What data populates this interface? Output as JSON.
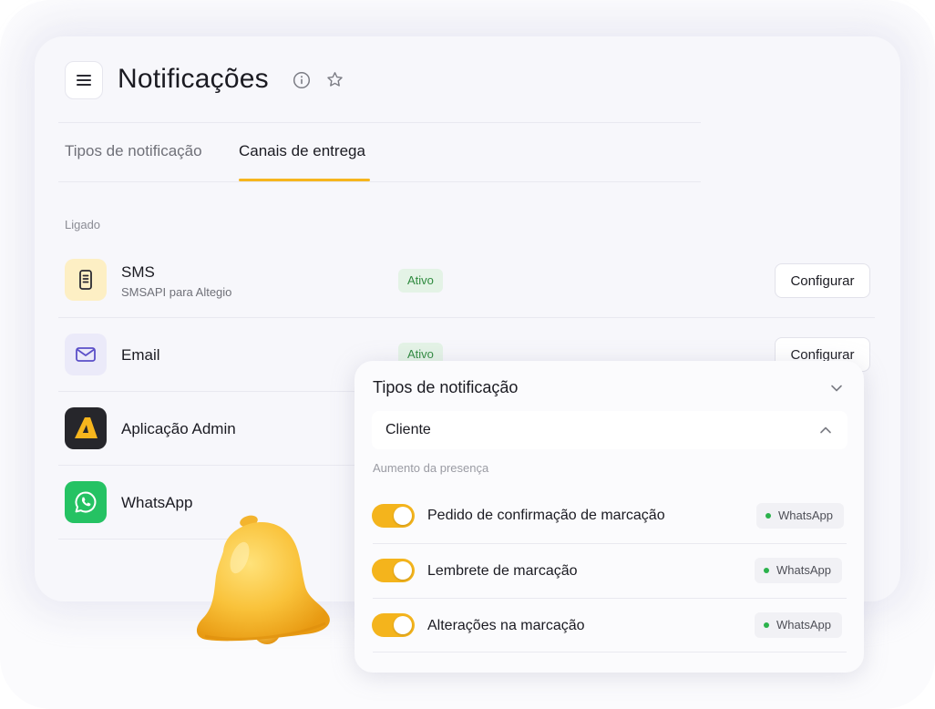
{
  "header": {
    "title": "Notificações",
    "menu_icon": "hamburger-menu-icon",
    "info_icon": "info-icon",
    "favorite_icon": "star-icon"
  },
  "tabs": [
    {
      "label": "Tipos de notificação",
      "active": false
    },
    {
      "label": "Canais de entrega",
      "active": true
    }
  ],
  "channels": {
    "section_label": "Ligado",
    "items": [
      {
        "name": "SMS",
        "subtitle": "SMSAPI para Altegio",
        "status": "Ativo",
        "action": "Configurar",
        "icon": "phone-icon"
      },
      {
        "name": "Email",
        "subtitle": "",
        "status": "Ativo",
        "action": "Configurar",
        "icon": "mail-icon"
      },
      {
        "name": "Aplicação Admin",
        "subtitle": "",
        "status": "",
        "action": "",
        "icon": "altegio-logo-icon"
      },
      {
        "name": "WhatsApp",
        "subtitle": "",
        "status": "",
        "action": "",
        "icon": "whatsapp-icon"
      }
    ]
  },
  "popup": {
    "title": "Tipos de notificação",
    "dropdown_value": "Cliente",
    "group_label": "Aumento da presença",
    "items": [
      {
        "label": "Pedido de confirmação de marcação",
        "enabled": true,
        "channel": "WhatsApp"
      },
      {
        "label": "Lembrete de marcação",
        "enabled": true,
        "channel": "WhatsApp"
      },
      {
        "label": "Alterações na marcação",
        "enabled": true,
        "channel": "WhatsApp"
      }
    ]
  },
  "decoration": {
    "icon": "bell-icon"
  },
  "colors": {
    "accent": "#F6B51D",
    "status_green_bg": "#E4F3E6",
    "status_green_text": "#2E8A3E",
    "whatsapp_green": "#25C263",
    "chip_dot": "#2BB24C"
  }
}
